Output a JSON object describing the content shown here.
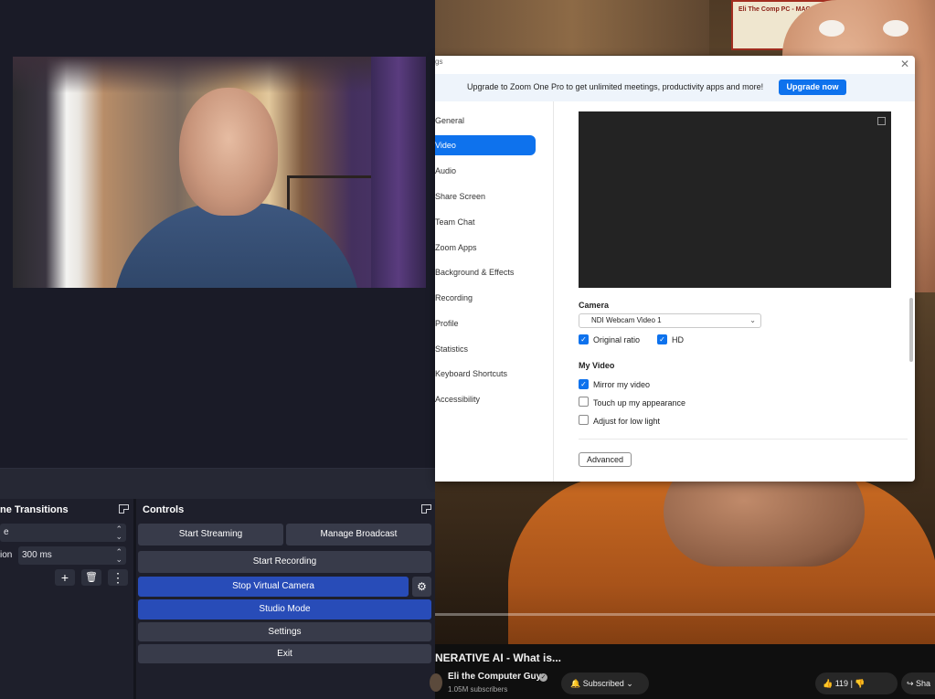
{
  "obs": {
    "transitions_title": "ne Transitions",
    "transition_select": "e",
    "duration_label": "ion",
    "duration_value": "300 ms",
    "add_icon": "+",
    "trash_icon": "🗑",
    "more_icon": "⋮",
    "controls_title": "Controls",
    "start_streaming": "Start Streaming",
    "manage_broadcast": "Manage Broadcast",
    "start_recording": "Start Recording",
    "stop_virtual_camera": "Stop Virtual Camera",
    "gear_icon": "⚙",
    "studio_mode": "Studio Mode",
    "settings": "Settings",
    "exit": "Exit",
    "accent_blue": "#284cb8"
  },
  "zoom": {
    "title_fragment": "gs",
    "close_icon": "✕",
    "banner_text": "Upgrade to Zoom One Pro to get unlimited meetings, productivity apps and more!",
    "upgrade_button": "Upgrade now",
    "nav": [
      "General",
      "Video",
      "Audio",
      "Share Screen",
      "Team Chat",
      "Zoom Apps",
      "Background & Effects",
      "Recording",
      "Profile",
      "Statistics",
      "Keyboard Shortcuts",
      "Accessibility"
    ],
    "active_nav": "Video",
    "camera_heading": "Camera",
    "camera_value": "NDI Webcam Video 1",
    "original_ratio": "Original ratio",
    "original_ratio_checked": true,
    "hd": "HD",
    "hd_checked": true,
    "my_video_heading": "My Video",
    "mirror": "Mirror my video",
    "mirror_checked": true,
    "touch_up": "Touch up my appearance",
    "touch_up_checked": false,
    "low_light": "Adjust for low light",
    "low_light_checked": false,
    "advanced_button": "Advanced",
    "accent_blue": "#0e72ed"
  },
  "youtube": {
    "video_title": "NERATIVE AI - What is...",
    "channel": "Eli the Computer Guy",
    "subscribers": "1.05M subscribers",
    "subscribed": "Subscribed",
    "likes": "119",
    "share": "Sha",
    "sign_text": "Eli The Comp PC - MAC - REPA"
  }
}
